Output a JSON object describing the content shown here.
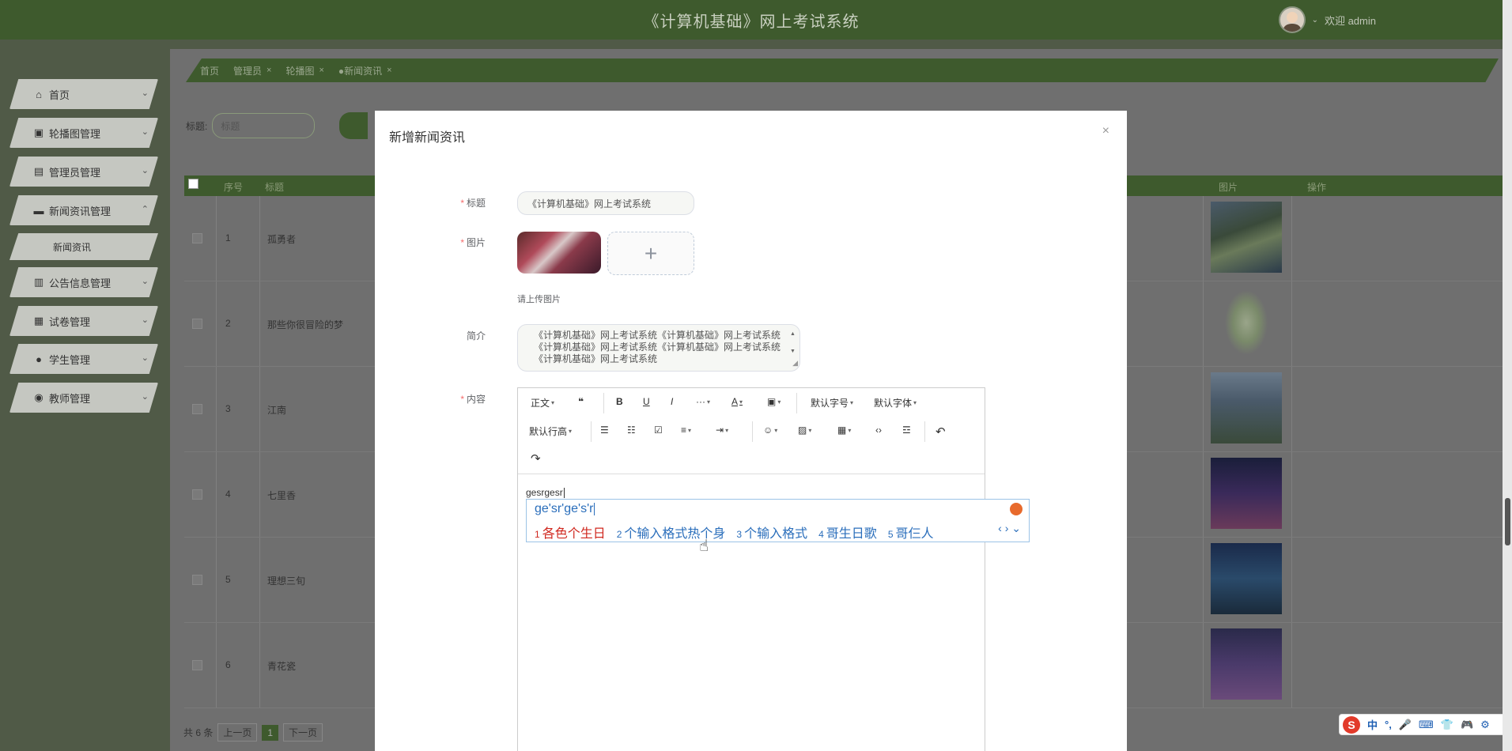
{
  "header": {
    "title": "《计算机基础》网上考试系统",
    "welcome": "欢迎 admin"
  },
  "sidebar": {
    "items": [
      {
        "label": "首页",
        "icon": "home-icon",
        "glyph": "⌂",
        "chevron": "⌄"
      },
      {
        "label": "轮播图管理",
        "icon": "carousel-icon",
        "glyph": "▣",
        "chevron": "⌄"
      },
      {
        "label": "管理员管理",
        "icon": "admin-icon",
        "glyph": "▤",
        "chevron": "⌄"
      },
      {
        "label": "新闻资讯管理",
        "icon": "news-icon",
        "glyph": "▬",
        "chevron": "⌃"
      },
      {
        "label": "公告信息管理",
        "icon": "briefcase-icon",
        "glyph": "▥",
        "chevron": "⌄"
      },
      {
        "label": "试卷管理",
        "icon": "grid-icon",
        "glyph": "▦",
        "chevron": "⌄"
      },
      {
        "label": "学生管理",
        "icon": "user-icon",
        "glyph": "●",
        "chevron": "⌄"
      },
      {
        "label": "教师管理",
        "icon": "teacher-icon",
        "glyph": "◉",
        "chevron": "⌄"
      }
    ],
    "sub_item": "新闻资讯"
  },
  "tabs": [
    {
      "label": "首页"
    },
    {
      "label": "管理员",
      "close": "×"
    },
    {
      "label": "轮播图",
      "close": "×"
    },
    {
      "label": "●新闻资讯",
      "close": "×"
    }
  ],
  "search": {
    "label": "标题:",
    "placeholder": "标题"
  },
  "table": {
    "headers": [
      "序号",
      "标题",
      "图片",
      "操作"
    ],
    "rows": [
      {
        "index": "1",
        "title": "孤勇者"
      },
      {
        "index": "2",
        "title": "那些你很冒险的梦"
      },
      {
        "index": "3",
        "title": "江南"
      },
      {
        "index": "4",
        "title": "七里香"
      },
      {
        "index": "5",
        "title": "理想三旬"
      },
      {
        "index": "6",
        "title": "青花瓷"
      }
    ]
  },
  "pager": {
    "total": "共 6 条",
    "prev": "上一页",
    "page": "1",
    "next": "下一页"
  },
  "modal": {
    "title": "新增新闻资讯",
    "close": "×",
    "labels": {
      "title": "标题",
      "image": "图片",
      "intro": "简介",
      "content": "内容"
    },
    "title_value": "《计算机基础》网上考试系统",
    "upload_tip": "请上传图片",
    "upload_plus": "+",
    "intro_value": "《计算机基础》网上考试系统《计算机基础》网上考试系统《计算机基础》网上考试系统《计算机基础》网上考试系统《计算机基础》网上考试系统",
    "editor": {
      "paragraph": "正文",
      "font_size": "默认字号",
      "font_family": "默认字体",
      "line_height": "默认行高",
      "body_text": "gesrgesr"
    }
  },
  "ime": {
    "composition": "ge'sr'ge's'r",
    "candidates": [
      {
        "n": "1",
        "text": "各色个生日"
      },
      {
        "n": "2",
        "text": "个输入格式热个身"
      },
      {
        "n": "3",
        "text": "个输入格式"
      },
      {
        "n": "4",
        "text": "哥生日歌"
      },
      {
        "n": "5",
        "text": "哥仨人"
      }
    ],
    "nav": "‹ › ⌄"
  },
  "sogou": {
    "logo": "S",
    "items": [
      "中",
      "°,",
      "🎤",
      "⌨",
      "👕",
      "🎮",
      "⚙"
    ]
  }
}
